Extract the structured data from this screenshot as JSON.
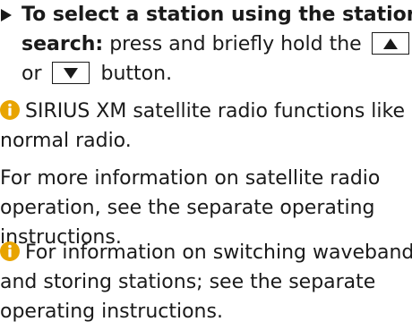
{
  "step": {
    "heading_line1": "To select a station using the station",
    "heading_bold2": "search:",
    "text2": "press and briefly hold the",
    "or": "or",
    "text3": "button."
  },
  "note1": {
    "line1": "SIRIUS XM satellite radio functions like a",
    "line2": "normal radio.",
    "line3": "For more information on satellite radio",
    "line4": "operation, see the separate operating",
    "line5": "instructions."
  },
  "note2": {
    "line1": "For information on switching waveband",
    "line2": "and storing stations; see the separate",
    "line3": "operating instructions."
  },
  "icons": {
    "step_bullet": "triangle-right-icon",
    "up_key": "up-arrow-icon",
    "down_key": "down-arrow-icon",
    "info": "info-icon"
  },
  "colors": {
    "info_icon": "#e8a400",
    "text": "#1a1a1a"
  }
}
